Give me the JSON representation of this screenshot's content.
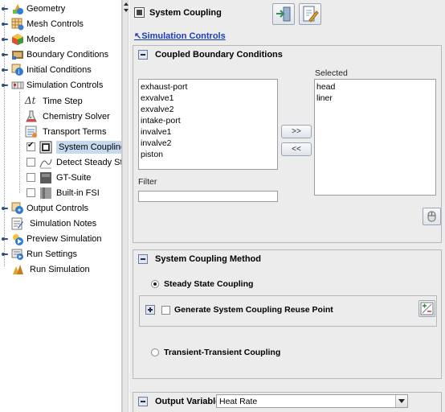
{
  "tree": {
    "items": [
      {
        "label": "Geometry",
        "icon": "geometry-icon"
      },
      {
        "label": "Mesh Controls",
        "icon": "mesh-controls-icon"
      },
      {
        "label": "Models",
        "icon": "models-icon"
      },
      {
        "label": "Boundary Conditions",
        "icon": "boundary-conditions-icon"
      },
      {
        "label": "Initial Conditions",
        "icon": "initial-conditions-icon"
      },
      {
        "label": "Simulation Controls",
        "icon": "simulation-controls-icon"
      },
      {
        "label": "Time Step",
        "icon": "time-step-icon",
        "glyph": "Δt"
      },
      {
        "label": "Chemistry Solver",
        "icon": "chemistry-solver-icon"
      },
      {
        "label": "Transport Terms",
        "icon": "transport-terms-icon"
      },
      {
        "label": "System Coupling",
        "icon": "system-coupling-icon",
        "checked": true,
        "selected": true
      },
      {
        "label": "Detect Steady State",
        "icon": "detect-steady-state-icon",
        "checked": false
      },
      {
        "label": "GT-Suite",
        "icon": "gt-suite-icon",
        "checked": false
      },
      {
        "label": "Built-in FSI",
        "icon": "built-in-fsi-icon",
        "checked": false
      },
      {
        "label": "Output Controls",
        "icon": "output-controls-icon"
      },
      {
        "label": "Simulation Notes",
        "icon": "simulation-notes-icon"
      },
      {
        "label": "Preview Simulation",
        "icon": "preview-simulation-icon"
      },
      {
        "label": "Run Settings",
        "icon": "run-settings-icon"
      },
      {
        "label": "Run Simulation",
        "icon": "run-simulation-icon"
      }
    ]
  },
  "panel": {
    "title": "System Coupling",
    "breadcrumb_link": "Simulation Controls",
    "breadcrumb_arrow": "↖",
    "toolbar": {
      "button1_icon": "exit-panel-icon",
      "button2_icon": "edit-document-icon"
    }
  },
  "coupled_bc": {
    "title": "Coupled Boundary Conditions",
    "available": [
      "exhaust-port",
      "exvalve1",
      "exvalve2",
      "intake-port",
      "invalve1",
      "invalve2",
      "piston"
    ],
    "selected_label": "Selected",
    "selected": [
      "head",
      "liner"
    ],
    "add_label": ">>",
    "remove_label": "<<",
    "filter_label": "Filter",
    "filter_value": ""
  },
  "coupling_method": {
    "title": "System Coupling Method",
    "options": [
      {
        "label": "Steady State Coupling",
        "selected": true
      },
      {
        "label": "Transient-Transient Coupling",
        "selected": false
      }
    ],
    "reuse_point_label": "Generate System Coupling Reuse Point",
    "reuse_point_checked": false
  },
  "output": {
    "label": "Output Variables",
    "value": "Heat Rate"
  },
  "colors": {
    "selection_bg": "#c5d9ef",
    "link": "#1a3db8",
    "panel_bg": "#ececec"
  }
}
